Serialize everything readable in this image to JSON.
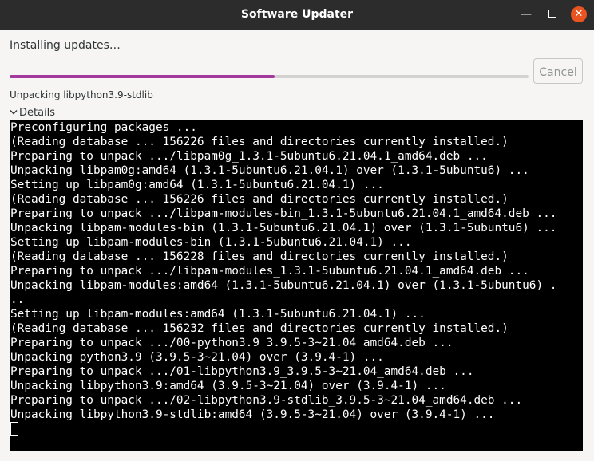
{
  "window": {
    "title": "Software Updater",
    "minimize_glyph": "—",
    "close_glyph": "✕"
  },
  "status": {
    "title": "Installing updates…",
    "current_action": "Unpacking libpython3.9-stdlib",
    "progress_fraction": 0.51
  },
  "cancel_button": {
    "label": "Cancel"
  },
  "details": {
    "label": "Details"
  },
  "terminal": {
    "lines": [
      "Preconfiguring packages ...",
      "(Reading database ... 156226 files and directories currently installed.)",
      "Preparing to unpack .../libpam0g_1.3.1-5ubuntu6.21.04.1_amd64.deb ...",
      "Unpacking libpam0g:amd64 (1.3.1-5ubuntu6.21.04.1) over (1.3.1-5ubuntu6) ...",
      "Setting up libpam0g:amd64 (1.3.1-5ubuntu6.21.04.1) ...",
      "(Reading database ... 156226 files and directories currently installed.)",
      "Preparing to unpack .../libpam-modules-bin_1.3.1-5ubuntu6.21.04.1_amd64.deb ...",
      "Unpacking libpam-modules-bin (1.3.1-5ubuntu6.21.04.1) over (1.3.1-5ubuntu6) ...",
      "Setting up libpam-modules-bin (1.3.1-5ubuntu6.21.04.1) ...",
      "(Reading database ... 156228 files and directories currently installed.)",
      "Preparing to unpack .../libpam-modules_1.3.1-5ubuntu6.21.04.1_amd64.deb ...",
      "Unpacking libpam-modules:amd64 (1.3.1-5ubuntu6.21.04.1) over (1.3.1-5ubuntu6) .",
      "..",
      "Setting up libpam-modules:amd64 (1.3.1-5ubuntu6.21.04.1) ...",
      "(Reading database ... 156232 files and directories currently installed.)",
      "Preparing to unpack .../00-python3.9_3.9.5-3~21.04_amd64.deb ...",
      "Unpacking python3.9 (3.9.5-3~21.04) over (3.9.4-1) ...",
      "Preparing to unpack .../01-libpython3.9_3.9.5-3~21.04_amd64.deb ...",
      "Unpacking libpython3.9:amd64 (3.9.5-3~21.04) over (3.9.4-1) ...",
      "Preparing to unpack .../02-libpython3.9-stdlib_3.9.5-3~21.04_amd64.deb ...",
      "Unpacking libpython3.9-stdlib:amd64 (3.9.5-3~21.04) over (3.9.4-1) ..."
    ]
  },
  "colors": {
    "titlebar": "#2c2c2c",
    "close_button": "#e95420",
    "progress": "#a4399e",
    "terminal_bg": "#000000",
    "terminal_fg": "#ffffff"
  }
}
